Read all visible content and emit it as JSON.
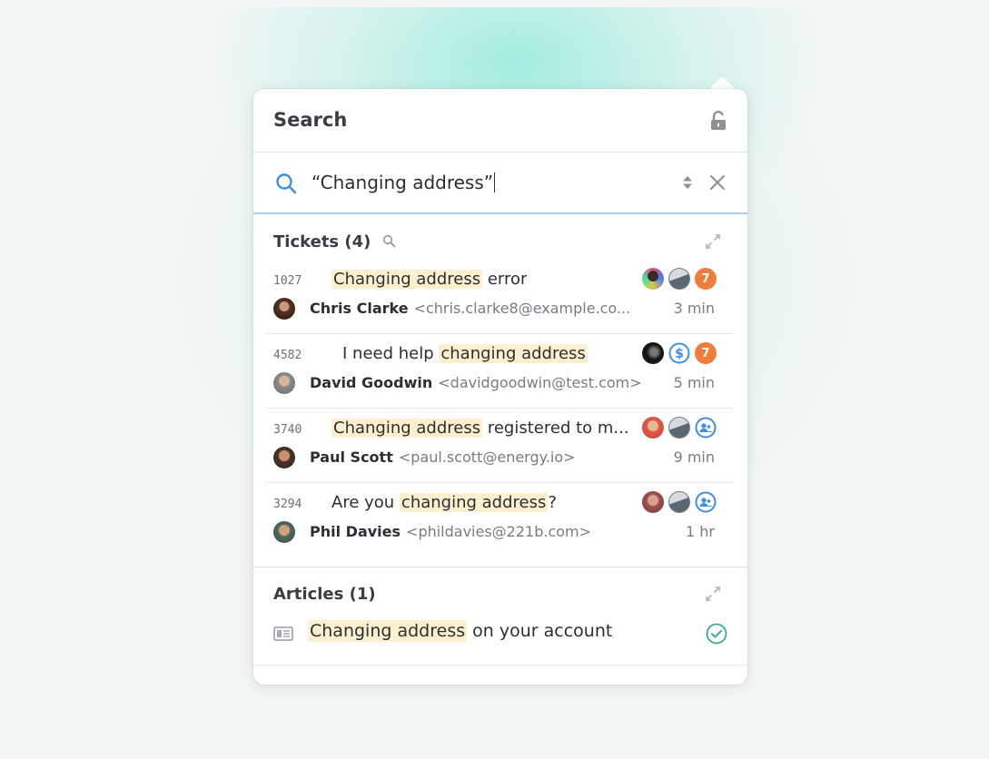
{
  "header": {
    "title": "Search"
  },
  "search": {
    "query": "“Changing address”"
  },
  "tickets": {
    "heading": "Tickets (4)",
    "items": [
      {
        "id": "1027",
        "subject_hl": "Changing address",
        "subject_rest": " error",
        "subject_pre": "",
        "name": "Chris Clarke",
        "email": "<chris.clarke8@example.co...",
        "time": "3 min",
        "badge_count": "7"
      },
      {
        "id": "4582",
        "subject_pre": "I need help ",
        "subject_hl": "changing address",
        "subject_rest": "",
        "name": "David Goodwin",
        "email": "<davidgoodwin@test.com>",
        "time": "5 min",
        "badge_count": "7"
      },
      {
        "id": "3740",
        "subject_pre": "",
        "subject_hl": "Changing address",
        "subject_rest": " registered to m...",
        "name": "Paul Scott",
        "email": "<paul.scott@energy.io>",
        "time": "9 min"
      },
      {
        "id": "3294",
        "subject_pre": "Are you ",
        "subject_hl": "changing address",
        "subject_rest": "?",
        "name": "Phil Davies",
        "email": "<phildavies@221b.com>",
        "time": "1 hr"
      }
    ]
  },
  "articles": {
    "heading": "Articles (1)",
    "items": [
      {
        "hl": "Changing address",
        "rest": " on your account"
      }
    ]
  },
  "colors": {
    "orange_badge": "#ef7d3b",
    "blue_accent": "#3f8fde",
    "teal_check": "#3aa99b",
    "highlight": "#fdf0cf"
  },
  "icons": [
    "lock-open-icon",
    "search-icon",
    "sort-icon",
    "close-icon",
    "expand-icon",
    "dollar-icon",
    "group-icon",
    "document-icon",
    "check-circle-icon"
  ]
}
